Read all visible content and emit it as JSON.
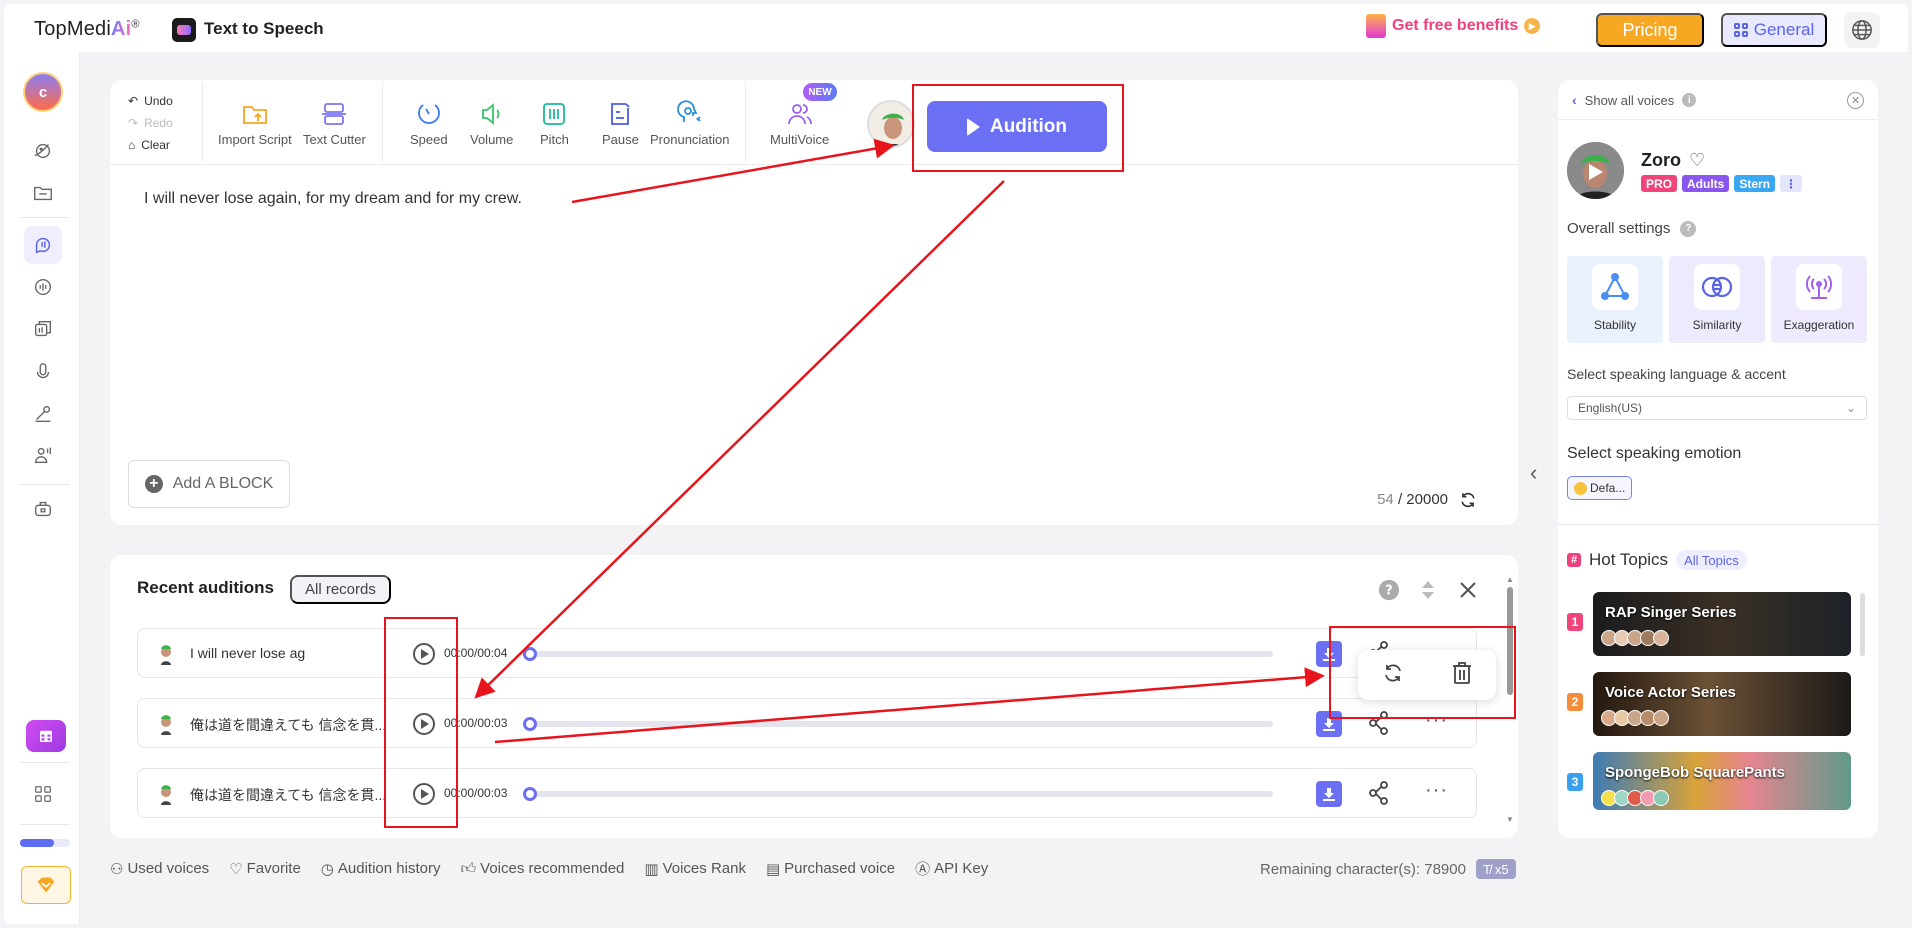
{
  "topbar": {
    "brand": "TopMedi",
    "brand_ai": "Ai",
    "brand_reg": "®",
    "app_title": "Text to Speech",
    "benefits": "Get free benefits",
    "pricing": "Pricing",
    "general": "General"
  },
  "sidebar": {
    "avatar_letter": "c",
    "progress": 0.68
  },
  "toolbar": {
    "undo": "Undo",
    "redo": "Redo",
    "clear": "Clear",
    "tools": [
      {
        "label": "Import Script",
        "icon": "folder-upload-icon"
      },
      {
        "label": "Text Cutter",
        "icon": "text-cutter-icon"
      },
      {
        "label": "Speed",
        "icon": "speed-icon"
      },
      {
        "label": "Volume",
        "icon": "volume-icon"
      },
      {
        "label": "Pitch",
        "icon": "pitch-icon"
      },
      {
        "label": "Pause",
        "icon": "pause-icon"
      },
      {
        "label": "Pronunciation",
        "icon": "pronunciation-icon"
      },
      {
        "label": "MultiVoice",
        "icon": "multivoice-icon"
      }
    ],
    "new_badge": "NEW",
    "audition": "Audition"
  },
  "editor": {
    "text": "I will never lose again, for my dream and for my crew.",
    "add_block": "Add A BLOCK",
    "char_count": "54",
    "char_limit": "/ 20000"
  },
  "recent": {
    "title": "Recent auditions",
    "all_records": "All records",
    "rows": [
      {
        "text": "I will never lose ag",
        "time": "00:00/00:04",
        "progress": 0
      },
      {
        "text": "俺は道を間違えても 信念を貫...",
        "time": "00:00/00:03",
        "progress": 0
      },
      {
        "text": "俺は道を間違えても 信念を貫...",
        "time": "00:00/00:03",
        "progress": 0
      }
    ],
    "more": "···"
  },
  "bottom": {
    "links": [
      "Used voices",
      "Favorite",
      "Audition history",
      "Voices recommended",
      "Voices Rank",
      "Purchased voice",
      "API Key"
    ],
    "remaining": "Remaining character(s): 78900",
    "multiplier": "x5"
  },
  "panel": {
    "show_all": "Show all voices",
    "voice_name": "Zoro",
    "tags": [
      {
        "label": "PRO",
        "color": "#f0457a"
      },
      {
        "label": "Adults",
        "color": "#8b55ef"
      },
      {
        "label": "Stern",
        "color": "#3aa8f0"
      }
    ],
    "overall": "Overall settings",
    "settings": [
      "Stability",
      "Similarity",
      "Exaggeration"
    ],
    "language_label": "Select speaking language & accent",
    "language_value": "English(US)",
    "emotion_label": "Select speaking emotion",
    "emotion_value": "Defa...",
    "hot_topics": "Hot Topics",
    "all_topics": "All Topics",
    "topics": [
      {
        "rank": "1",
        "title": "RAP Singer Series",
        "rank_color": "#f0457a"
      },
      {
        "rank": "2",
        "title": "Voice Actor Series",
        "rank_color": "#f58c3c"
      },
      {
        "rank": "3",
        "title": "SpongeBob SquarePants",
        "rank_color": "#3aa0f0"
      }
    ]
  },
  "colors": {
    "accent": "#6a6ff4",
    "pricing": "#f7a823",
    "annotation": "#e8141b"
  }
}
